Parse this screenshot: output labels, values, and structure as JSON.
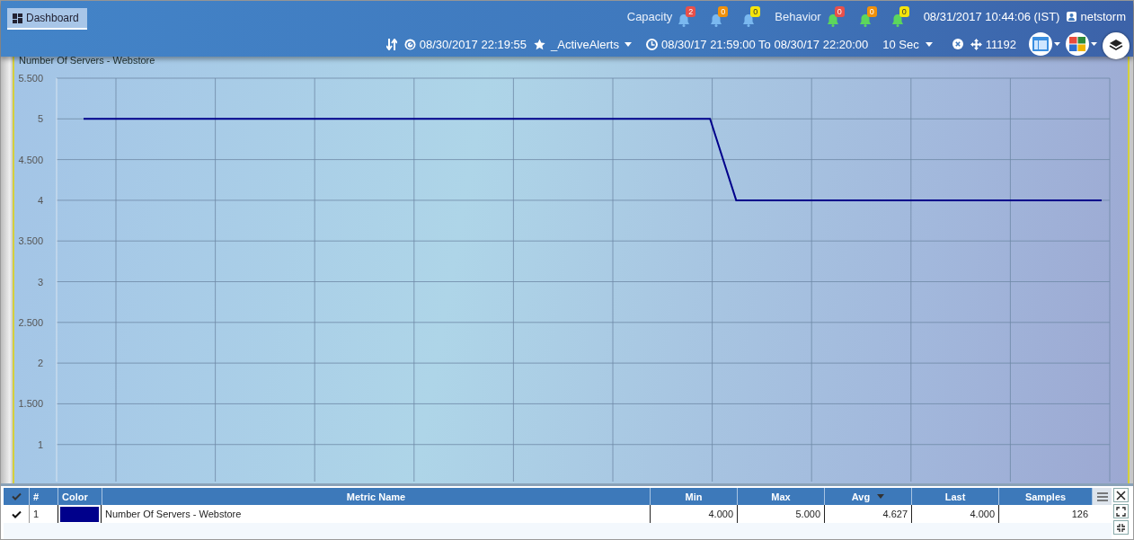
{
  "tabs": [
    {
      "label": "Dashboard",
      "selected": true
    }
  ],
  "alerts": {
    "capacity_label": "Capacity",
    "capacity": [
      {
        "count": "2",
        "color": "#e8504a"
      },
      {
        "count": "0",
        "color": "#f0900a"
      },
      {
        "count": "0",
        "color": "#f4e40a"
      }
    ],
    "behavior_label": "Behavior",
    "behavior": [
      {
        "count": "0",
        "color": "#e8504a"
      },
      {
        "count": "0",
        "color": "#f0900a"
      },
      {
        "count": "0",
        "color": "#f4e40a"
      }
    ],
    "datetime": "08/31/2017 10:44:06 (IST)",
    "user": "netstorm"
  },
  "toolbar": {
    "time": "08/30/2017 22:19:55",
    "favorite": "_ActiveAlerts",
    "range": "08/30/17 21:59:00 To 08/30/17 22:20:00",
    "interval": "10 Sec",
    "count": "11192"
  },
  "panel": {
    "title": "Number Of Servers - Webstore",
    "chart_data": {
      "type": "line",
      "grid": true,
      "series": [
        {
          "color": "#00008b",
          "values": [
            5,
            5,
            5,
            5,
            5,
            5,
            5,
            5,
            5,
            5,
            5,
            5,
            5,
            5,
            5,
            5,
            5,
            5,
            5,
            5,
            5,
            5,
            5,
            5,
            5,
            4,
            4,
            4,
            4,
            4,
            4,
            4,
            4,
            4,
            4,
            4,
            4,
            4,
            4,
            4
          ]
        }
      ],
      "ylim": [
        0.55,
        5.5
      ],
      "yticks": [
        1,
        2,
        3,
        4,
        5
      ]
    },
    "y_axis_labels": [
      "5.500",
      "5",
      "4.500",
      "4",
      "3.500",
      "3",
      "2.500",
      "2",
      "1.500",
      "1"
    ]
  },
  "table": {
    "columns": [
      {
        "label": "#",
        "sorted": false
      },
      {
        "label": "Color",
        "sorted": false
      },
      {
        "label": "Metric Name",
        "sorted": false
      },
      {
        "label": "Min",
        "sorted": false
      },
      {
        "label": "Max",
        "sorted": false
      },
      {
        "label": "Avg",
        "sorted": true
      },
      {
        "label": "Last",
        "sorted": false
      },
      {
        "label": "Samples",
        "sorted": false
      }
    ],
    "rows": [
      {
        "checked": true,
        "index": "1",
        "color": "#00008b",
        "metric": "Number Of Servers - Webstore",
        "min": "4.000",
        "max": "5.000",
        "avg": "4.627",
        "last": "4.000",
        "samples": "126"
      }
    ]
  }
}
